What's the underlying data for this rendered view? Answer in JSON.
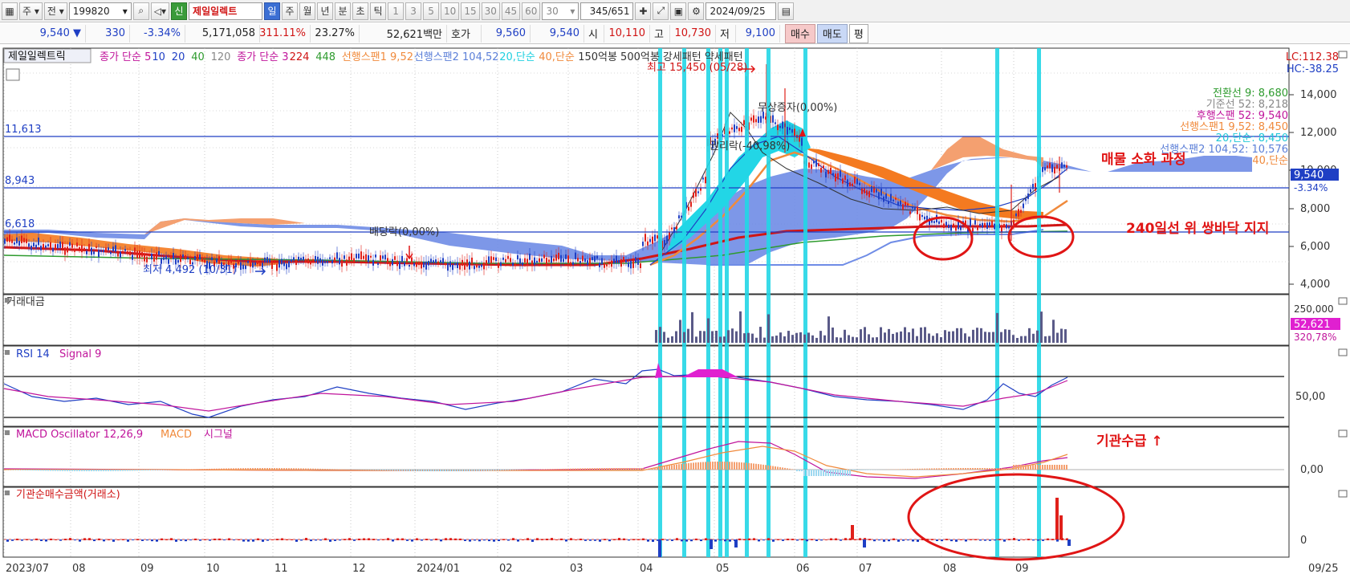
{
  "toolbar": {
    "market": "주",
    "prev": "전",
    "code": "199820",
    "new_badge": "신",
    "stock_name": "제일일렉트",
    "periods": [
      "일",
      "주",
      "월",
      "년",
      "분",
      "초",
      "틱"
    ],
    "intervals": [
      "1",
      "3",
      "5",
      "10",
      "15",
      "30",
      "45",
      "60"
    ],
    "interval_select": "30",
    "count": "345",
    "count_total": "/651",
    "date": "2024/09/25"
  },
  "info": {
    "price": "9,540",
    "arrow": "▼",
    "change": "330",
    "change_pct": "-3.34%",
    "volume": "5,171,058",
    "vol_ratio": "311.11%",
    "turnover": "23.27%",
    "amount": "52,621백만",
    "quote_label": "호가",
    "ask": "9,560",
    "bid": "9,540",
    "open_label": "시",
    "open": "10,110",
    "high_label": "고",
    "high": "10,730",
    "low_label": "저",
    "low": "9,100",
    "buy": "매수",
    "sell": "매도",
    "eq": "평"
  },
  "main_legend": {
    "name": "제일일렉트릭",
    "items": [
      {
        "text": "종가 단순 5",
        "color": "#c0149b"
      },
      {
        "text": "10",
        "color": "#1f3fc4"
      },
      {
        "text": "20",
        "color": "#1f3fc4"
      },
      {
        "text": "40",
        "color": "#2e9b2e"
      },
      {
        "text": "120",
        "color": "#888888"
      },
      {
        "text": "종가 단순 3",
        "color": "#c0149b"
      },
      {
        "text": "224",
        "color": "#d01515"
      },
      {
        "text": "448",
        "color": "#2e9b2e"
      },
      {
        "text": "선행스팬1 9,52",
        "color": "#f08a3c"
      },
      {
        "text": "선행스팬2 104,52",
        "color": "#5b7fd8"
      },
      {
        "text": "20,단순",
        "color": "#20d0e0"
      },
      {
        "text": "40,단순",
        "color": "#f08a3c"
      },
      {
        "text": "150억봉 500억봉 강세패턴 약세패턴",
        "color": "#333333"
      }
    ]
  },
  "ichimoku_labels": [
    {
      "text": "전환선 9: 8,680",
      "color": "#2e9b2e"
    },
    {
      "text": "기준선 52: 8,218",
      "color": "#888888"
    },
    {
      "text": "후행스팬 52: 9,540",
      "color": "#c0149b"
    },
    {
      "text": "선행스팬1 9,52: 8,450",
      "color": "#f08a3c"
    },
    {
      "text": "20,단순: 8,450",
      "color": "#20c8d8"
    },
    {
      "text": "선행스팬2 104,52: 10,576",
      "color": "#5b7fd8"
    },
    {
      "text": "40,단순",
      "color": "#f08a3c"
    }
  ],
  "corner": {
    "lc": "LC:112.38",
    "hc": "HC:-38.25"
  },
  "price_axis": [
    "14,000",
    "12,000",
    "10,000",
    "8,000",
    "6,000",
    "4,000"
  ],
  "current_price_tag": {
    "price": "9,540",
    "pct": "-3.34%"
  },
  "hlines": [
    {
      "label": "11,613"
    },
    {
      "label": "8,943"
    },
    {
      "label": "6,618"
    }
  ],
  "chart_annotations": {
    "max_high": "최고 15,450 (05/28)",
    "min_low": "최저 4,492 (10/31)",
    "dividend": "배당락(0,00%)",
    "rights": "권리락(-40,98%)",
    "free_issue": "무상증자(0,00%)",
    "note1": "매물 소화 과정",
    "note2": "240일선 위 쌍바닥 지지",
    "note3": "기관수급 ↑"
  },
  "panels": {
    "volume": {
      "title": "거래대금",
      "axis": "250,000",
      "value_tag": "52,621",
      "pct_tag": "320,78%"
    },
    "rsi": {
      "title": "RSI 14",
      "signal": "Signal 9",
      "axis": "50,00"
    },
    "macd": {
      "title": "MACD Oscillator 12,26,9",
      "macd": "MACD",
      "signal": "시그널",
      "axis": "0,00"
    },
    "inst": {
      "title": "기관순매수금액(거래소)",
      "axis": "0"
    }
  },
  "x_axis": [
    "2023/07",
    "08",
    "09",
    "10",
    "11",
    "12",
    "2024/01",
    "02",
    "03",
    "04",
    "05",
    "06",
    "07",
    "08",
    "09"
  ],
  "x_axis_right": "09/25",
  "colors": {
    "up": "#e0201a",
    "down": "#1f3fc4",
    "cyan": "#22d6e6",
    "cloud_blue": "#6f8ce6",
    "cloud_orange": "#f4a070"
  }
}
